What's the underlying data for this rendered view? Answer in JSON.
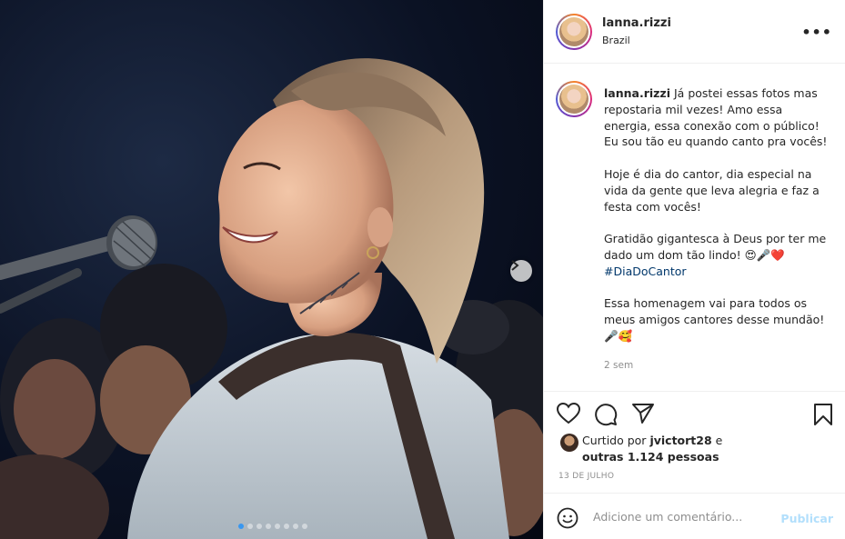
{
  "post": {
    "username": "lanna.rizzi",
    "location": "Brazil",
    "caption_paragraphs": [
      "Já postei essas fotos mas repostaria mil vezes! Amo essa energia, essa conexão com o público! Eu sou tão eu quando canto pra vocês!",
      "Hoje é dia do cantor, dia especial na vida da gente que leva alegria e faz a festa com vocês!",
      "Gratidão gigantesca à Deus por ter me dado um dom tão lindo! 😍🎤❤️",
      "Essa homenagem vai para todos os meus amigos cantores desse mundão! 🎤🥰"
    ],
    "hashtag": "#DiaDoCantor",
    "time_ago": "2 sem",
    "liked_by_prefix": "Curtido por",
    "liked_by_user": "jvictort28",
    "liked_by_and": "e",
    "liked_by_others": "outras 1.124 pessoas",
    "date": "13 DE JULHO",
    "more_label": "•••"
  },
  "comment_box": {
    "placeholder": "Adicione um comentário...",
    "post_label": "Publicar"
  },
  "carousel": {
    "total": 8,
    "active_index": 0
  },
  "icons": {
    "like": "heart-icon",
    "comment": "comment-icon",
    "share": "share-icon",
    "save": "bookmark-icon",
    "emoji": "smiley-icon",
    "next": "chevron-right-icon"
  },
  "colors": {
    "accent_link": "#00376b",
    "post_button_disabled": "#b2dffc",
    "active_dot": "#3897f0"
  }
}
